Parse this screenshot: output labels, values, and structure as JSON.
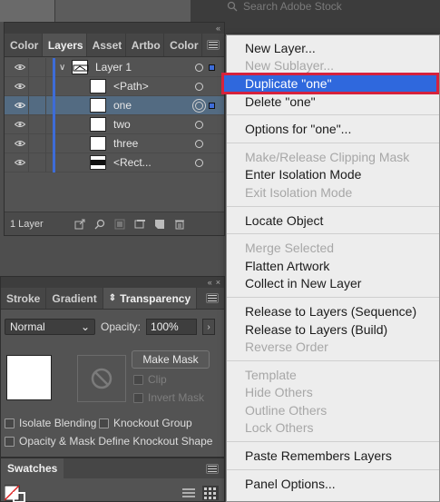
{
  "search": {
    "placeholder": "Search Adobe Stock"
  },
  "layers_panel": {
    "tabs": [
      "Color",
      "Layers",
      "Asset",
      "Artbo",
      "Color"
    ],
    "active_tab": "Layers",
    "rows": [
      {
        "label": "Layer 1",
        "thumb": "layer"
      },
      {
        "label": "<Path>",
        "thumb": "white"
      },
      {
        "label": "one",
        "thumb": "white",
        "selected": true
      },
      {
        "label": "two",
        "thumb": "white"
      },
      {
        "label": "three",
        "thumb": "white"
      },
      {
        "label": "<Rect...",
        "thumb": "black-mid"
      }
    ],
    "count": "1 Layer"
  },
  "transparency_panel": {
    "tabs": [
      "Stroke",
      "Gradient",
      "Transparency"
    ],
    "blend_mode": "Normal",
    "opacity_label": "Opacity:",
    "opacity_value": "100%",
    "make_mask": "Make Mask",
    "clip": "Clip",
    "invert_mask": "Invert Mask",
    "isolate_blending": "Isolate Blending",
    "knockout_group": "Knockout Group",
    "opacity_mask": "Opacity & Mask Define Knockout Shape"
  },
  "swatches_panel": {
    "tab": "Swatches"
  },
  "context_menu": {
    "groups": [
      [
        {
          "label": "New Layer...",
          "enabled": true
        },
        {
          "label": "New Sublayer...",
          "enabled": false
        },
        {
          "label": "Duplicate \"one\"",
          "enabled": true,
          "highlighted": true
        },
        {
          "label": "Delete \"one\"",
          "enabled": true
        }
      ],
      [
        {
          "label": "Options for \"one\"...",
          "enabled": true
        }
      ],
      [
        {
          "label": "Make/Release Clipping Mask",
          "enabled": false
        },
        {
          "label": "Enter Isolation Mode",
          "enabled": true
        },
        {
          "label": "Exit Isolation Mode",
          "enabled": false
        }
      ],
      [
        {
          "label": "Locate Object",
          "enabled": true
        }
      ],
      [
        {
          "label": "Merge Selected",
          "enabled": false
        },
        {
          "label": "Flatten Artwork",
          "enabled": true
        },
        {
          "label": "Collect in New Layer",
          "enabled": true
        }
      ],
      [
        {
          "label": "Release to Layers (Sequence)",
          "enabled": true
        },
        {
          "label": "Release to Layers (Build)",
          "enabled": true
        },
        {
          "label": "Reverse Order",
          "enabled": false
        }
      ],
      [
        {
          "label": "Template",
          "enabled": false
        },
        {
          "label": "Hide Others",
          "enabled": false
        },
        {
          "label": "Outline Others",
          "enabled": false
        },
        {
          "label": "Lock Others",
          "enabled": false
        }
      ],
      [
        {
          "label": "Paste Remembers Layers",
          "enabled": true
        }
      ],
      [
        {
          "label": "Panel Options...",
          "enabled": true
        }
      ]
    ]
  },
  "colors": {
    "selection_blue": "#2f68dd",
    "highlight_border": "#d6223c",
    "layer_bar": "#3d6cd8"
  }
}
